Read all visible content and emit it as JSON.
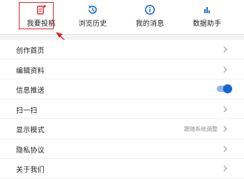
{
  "tabs": [
    {
      "label": "我要投稿",
      "icon": "edit-add-icon"
    },
    {
      "label": "浏览历史",
      "icon": "history-icon"
    },
    {
      "label": "我的消息",
      "icon": "info-icon"
    },
    {
      "label": "数据助手",
      "icon": "bar-chart-icon"
    }
  ],
  "menu": [
    {
      "label": "创作首页"
    },
    {
      "label": "编辑资料"
    },
    {
      "label": "信息推送",
      "toggle_on": true
    },
    {
      "label": "扫一扫"
    },
    {
      "label": "显示模式",
      "value": "跟随系统调整"
    },
    {
      "label": "隐私协议"
    },
    {
      "label": "关于我们"
    }
  ],
  "colors": {
    "accent": "#1565d0",
    "annotation": "#e02020"
  }
}
